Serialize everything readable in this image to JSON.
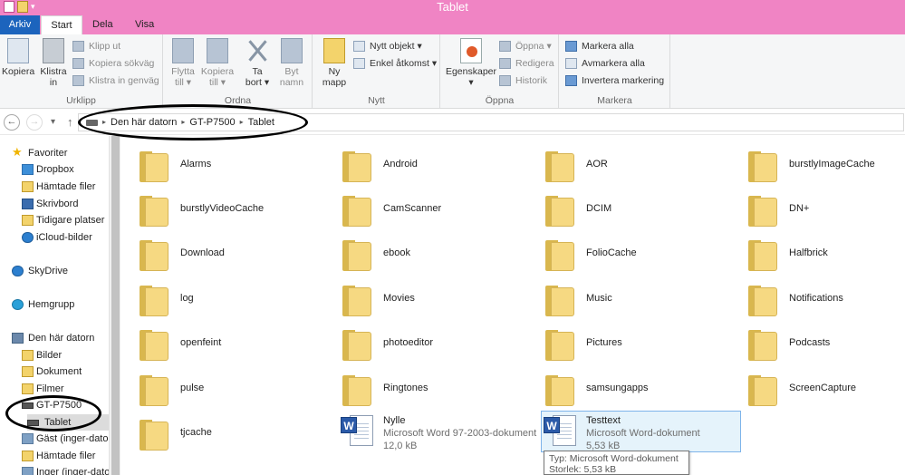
{
  "window": {
    "title": "Tablet"
  },
  "tabs": [
    {
      "label": "Arkiv"
    },
    {
      "label": "Start"
    },
    {
      "label": "Dela"
    },
    {
      "label": "Visa"
    }
  ],
  "ribbon": {
    "clipboard": {
      "label": "Urklipp",
      "copy": "Kopiera",
      "paste": [
        "Klistra",
        "in"
      ],
      "cut": "Klipp ut",
      "copy_path": "Kopiera sökväg",
      "paste_shortcut": "Klistra in genväg"
    },
    "organize": {
      "label": "Ordna",
      "move_to": [
        "Flytta",
        "till ▾"
      ],
      "copy_to": [
        "Kopiera",
        "till ▾"
      ],
      "delete": [
        "Ta",
        "bort ▾"
      ],
      "rename": [
        "Byt",
        "namn"
      ]
    },
    "new": {
      "label": "Nytt",
      "new_folder": [
        "Ny",
        "mapp"
      ],
      "new_item": "Nytt objekt ▾",
      "easy_access": "Enkel åtkomst ▾"
    },
    "open": {
      "label": "Öppna",
      "properties": [
        "Egenskaper",
        "▾"
      ],
      "open": "Öppna ▾",
      "edit": "Redigera",
      "history": "Historik"
    },
    "select": {
      "label": "Markera",
      "select_all": "Markera alla",
      "select_none": "Avmarkera alla",
      "invert": "Invertera markering"
    }
  },
  "address": {
    "crumbs": [
      "Den här datorn",
      "GT-P7500",
      "Tablet"
    ]
  },
  "nav_pane": {
    "favorites": "Favoriter",
    "favorites_items": [
      "Dropbox",
      "Hämtade filer",
      "Skrivbord",
      "Tidigare platser",
      "iCloud-bilder"
    ],
    "skydrive": "SkyDrive",
    "homegroup": "Hemgrupp",
    "this_pc": "Den här datorn",
    "pc_items": [
      "Bilder",
      "Dokument",
      "Filmer"
    ],
    "device": "GT-P7500",
    "device_child": "Tablet",
    "more_items": [
      "Gäst (inger-dator)",
      "Hämtade filer",
      "Inger (inger-dator)"
    ]
  },
  "folders": [
    [
      "Alarms",
      "Android",
      "AOR",
      "burstlyImageCache"
    ],
    [
      "burstlyVideoCache",
      "CamScanner",
      "DCIM",
      "DN+"
    ],
    [
      "Download",
      "ebook",
      "FolioCache",
      "Halfbrick"
    ],
    [
      "log",
      "Movies",
      "Music",
      "Notifications"
    ],
    [
      "openfeint",
      "photoeditor",
      "Pictures",
      "Podcasts"
    ],
    [
      "pulse",
      "Ringtones",
      "samsungapps",
      "ScreenCapture"
    ],
    [
      "tjcache"
    ]
  ],
  "files": [
    {
      "name": "Nylle",
      "type": "Microsoft Word 97-2003-dokument",
      "size": "12,0 kB",
      "icon": "word-doc-icon"
    },
    {
      "name": "Testtext",
      "type": "Microsoft Word-dokument",
      "size": "5,53 kB",
      "icon": "word-doc-icon"
    }
  ],
  "tooltip": {
    "line1": "Typ: Microsoft Word-dokument",
    "line2": "Storlek: 5,53 kB"
  },
  "colors": {
    "title_bar": "#f084c4",
    "file_tab": "#1c64bd",
    "folder": "#f6d982",
    "selection": "#e5f3fb",
    "annotation_ellipse": "#000000"
  }
}
